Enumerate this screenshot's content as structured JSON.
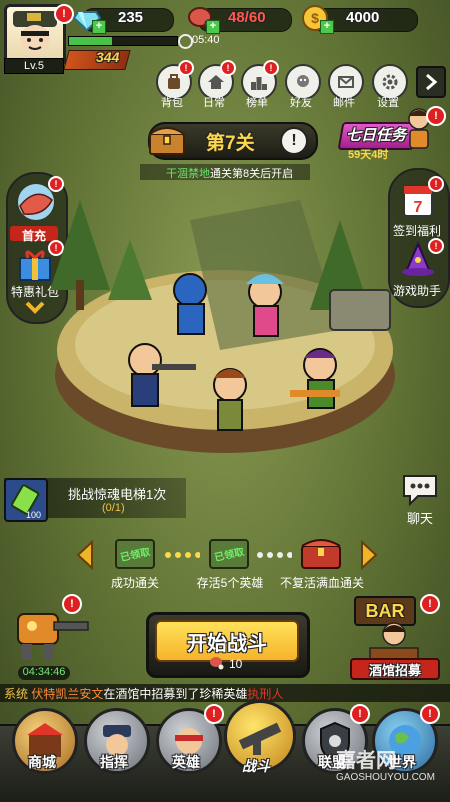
{
  "player": {
    "level": "Lv.5",
    "xp_time": "05:40",
    "power": "344"
  },
  "resources": {
    "diamonds": "235",
    "stamina": "48/60",
    "coins": "4000"
  },
  "top_menu": [
    {
      "label": "背包",
      "icon": "backpack-icon"
    },
    {
      "label": "日常",
      "icon": "house-icon"
    },
    {
      "label": "榜单",
      "icon": "podium-icon"
    },
    {
      "label": "好友",
      "icon": "friend-icon"
    },
    {
      "label": "邮件",
      "icon": "mail-icon"
    },
    {
      "label": "设置",
      "icon": "gear-icon"
    }
  ],
  "seven_day": {
    "title": "七日任务",
    "timer": "59天4时"
  },
  "stage": {
    "title": "第7关",
    "unlock_prefix": "干涸禁地",
    "unlock_text": "通关第8关后开启"
  },
  "left_panel": {
    "first_charge": "首充",
    "gift_pack": "特惠礼包"
  },
  "right_panel": {
    "sign_in": "签到福利",
    "assistant": "游戏助手",
    "calendar_day": "7"
  },
  "challenge": {
    "title": "挑战惊魂电梯1次",
    "progress": "(0/1)",
    "badge": "100"
  },
  "chat_label": "聊天",
  "rewards": {
    "claimed_label": "已领取",
    "items": [
      {
        "label": "成功通关"
      },
      {
        "label": "存活5个英雄"
      },
      {
        "label": "不复活满血通关"
      }
    ]
  },
  "battle": {
    "start_label": "开始战斗",
    "cost": "10"
  },
  "mech_timer": "04:34:46",
  "bar": {
    "sign": "BAR",
    "label": "酒馆招募"
  },
  "system_msg": {
    "tag": "系统",
    "name": "伏特凯兰安文",
    "mid": "在酒馆中招募到了珍稀英雄",
    "hero": "执刑人"
  },
  "bottom_nav": [
    {
      "label": "商城",
      "icon": "shop-icon"
    },
    {
      "label": "指挥",
      "icon": "commander-icon"
    },
    {
      "label": "英雄",
      "icon": "hero-icon"
    },
    {
      "label": "战斗",
      "icon": "battle-icon"
    },
    {
      "label": "联盟",
      "icon": "alliance-icon"
    },
    {
      "label": "世界",
      "icon": "world-icon"
    }
  ],
  "watermark": {
    "brand": "嘉者网",
    "url": "GAOSHOUYOU.COM"
  }
}
